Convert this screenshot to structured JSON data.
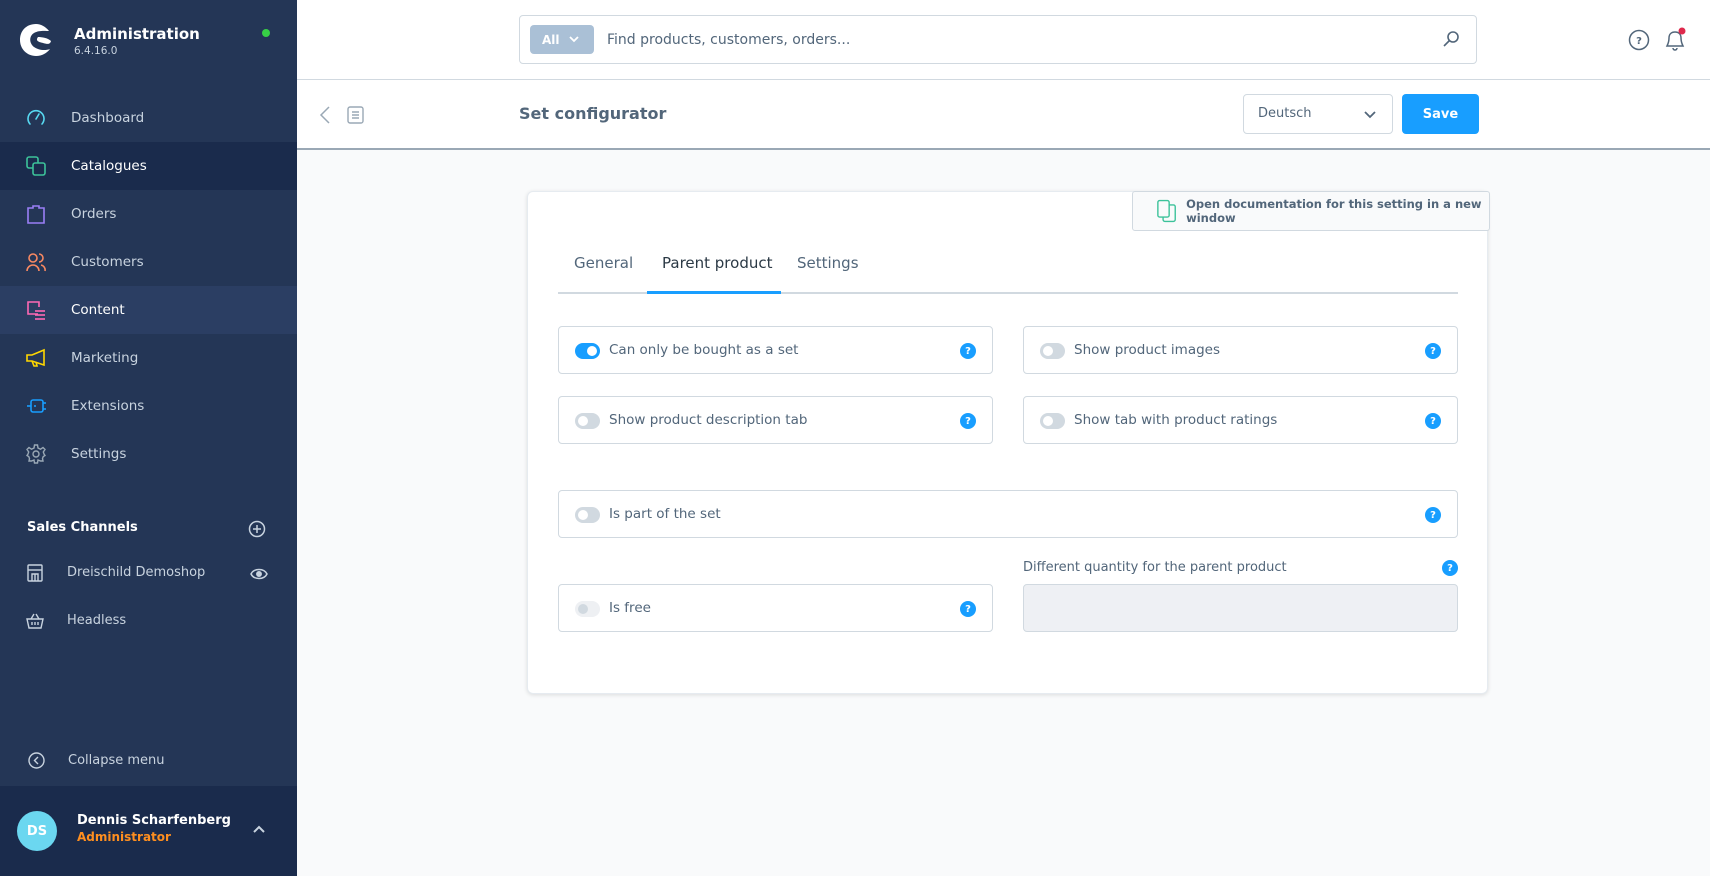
{
  "app": {
    "title": "Administration",
    "version": "6.4.16.0",
    "status_color": "#37d046"
  },
  "sidebar": {
    "items": [
      {
        "label": "Dashboard",
        "icon": "dashboard-icon",
        "color": "#57d9f1"
      },
      {
        "label": "Catalogues",
        "icon": "catalogues-icon",
        "color": "#3cc29a",
        "state": "active"
      },
      {
        "label": "Orders",
        "icon": "orders-icon",
        "color": "#9a7ff5"
      },
      {
        "label": "Customers",
        "icon": "customers-icon",
        "color": "#f88962"
      },
      {
        "label": "Content",
        "icon": "content-icon",
        "color": "#ff68b4",
        "state": "hover"
      },
      {
        "label": "Marketing",
        "icon": "marketing-icon",
        "color": "#ffd700"
      },
      {
        "label": "Extensions",
        "icon": "extensions-icon",
        "color": "#189eff"
      },
      {
        "label": "Settings",
        "icon": "settings-icon",
        "color": "#9aa8b5"
      }
    ],
    "sales_channels": {
      "title": "Sales Channels",
      "items": [
        {
          "label": "Dreischild Demoshop",
          "icon": "storefront-icon"
        },
        {
          "label": "Headless",
          "icon": "basket-icon"
        }
      ]
    },
    "collapse_label": "Collapse menu",
    "user": {
      "initials": "DS",
      "name": "Dennis Scharfenberg",
      "role": "Administrator"
    }
  },
  "topbar": {
    "search_type": "All",
    "search_placeholder": "Find products, customers, orders...",
    "search_value": ""
  },
  "smartbar": {
    "title": "Set configurator",
    "language": "Deutsch",
    "save_label": "Save"
  },
  "card": {
    "doc_link": "Open documentation for this setting in a new window",
    "tabs": [
      {
        "label": "General"
      },
      {
        "label": "Parent product",
        "active": true
      },
      {
        "label": "Settings"
      }
    ],
    "fields": {
      "bought_as_set": {
        "label": "Can only be bought as a set",
        "checked": true
      },
      "show_images": {
        "label": "Show product images",
        "checked": false
      },
      "show_description": {
        "label": "Show product description tab",
        "checked": false
      },
      "show_ratings": {
        "label": "Show tab with product ratings",
        "checked": false
      },
      "part_of_set": {
        "label": "Is part of the set",
        "checked": false
      },
      "is_free": {
        "label": "Is free",
        "checked": false,
        "disabled": true
      },
      "quantity": {
        "label": "Different quantity for the parent product",
        "value": "",
        "disabled": true
      }
    },
    "help_glyph": "?"
  },
  "colors": {
    "accent": "#189eff",
    "sidebar_bg": "#243656",
    "sidebar_active": "#1a2b4c",
    "role": "#ff8f1f",
    "notification": "#de294c"
  }
}
